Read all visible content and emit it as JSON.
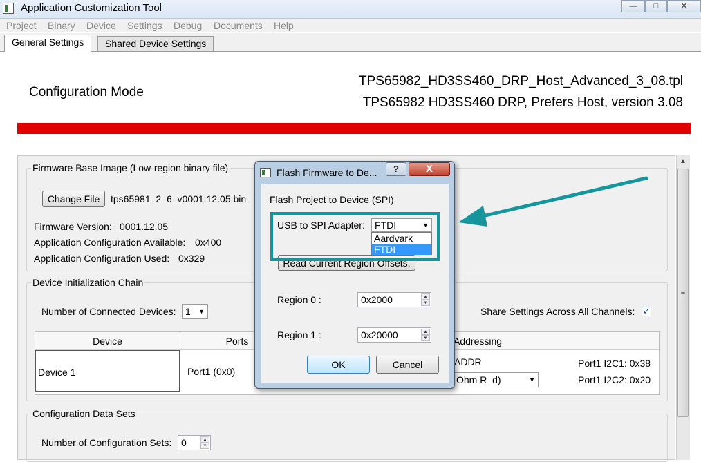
{
  "window": {
    "title": "Application Customization Tool"
  },
  "menu": [
    "Project",
    "Binary",
    "Device",
    "Settings",
    "Debug",
    "Documents",
    "Help"
  ],
  "tabs": [
    {
      "label": "General Settings",
      "active": true
    },
    {
      "label": "Shared Device Settings",
      "active": false
    }
  ],
  "header": {
    "mode": "Configuration Mode",
    "file": "TPS65982_HD3SS460_DRP_Host_Advanced_3_08.tpl",
    "description": "TPS65982 HD3SS460 DRP, Prefers Host, version 3.08",
    "accent_color": "#e00000"
  },
  "firmware": {
    "title": "Firmware Base Image (Low-region binary file)",
    "change_file": "Change File",
    "filename": "tps65981_2_6_v0001.12.05.bin",
    "version_label": "Firmware Version:",
    "version_value": "0001.12.05",
    "available_label": "Application Configuration Available:",
    "available_value": "0x400",
    "used_label": "Application Configuration Used:",
    "used_value": "0x329"
  },
  "chain": {
    "title": "Device Initialization Chain",
    "count_label": "Number of Connected Devices:",
    "count_value": "1",
    "share_label": "Share Settings Across All Channels:",
    "share_checked": true,
    "columns": [
      "Device",
      "Ports",
      "Addressing"
    ],
    "row": {
      "device": "Device 1",
      "ports": "Port1 (0x0)",
      "addr_label": "ADDR",
      "addr_combo": "Ohm R_d)",
      "i2c1": "Port1 I2C1: 0x38",
      "i2c2": "Port1 I2C2: 0x20"
    }
  },
  "datasets": {
    "title": "Configuration Data Sets",
    "count_label": "Number of Configuration Sets:",
    "count_value": "0"
  },
  "dialog": {
    "title": "Flash Firmware to De...",
    "help": "?",
    "close": "X",
    "heading": "Flash Project to Device (SPI)",
    "adapter_label": "USB to SPI Adapter:",
    "adapter_value": "FTDI",
    "adapter_options": [
      "Aardvark",
      "FTDI"
    ],
    "read_offsets": "Read Current Region Offsets.",
    "region0_label": "Region 0 :",
    "region0_value": "0x2000",
    "region1_label": "Region 1 :",
    "region1_value": "0x20000",
    "ok": "OK",
    "cancel": "Cancel",
    "highlight_color": "#16969c"
  }
}
